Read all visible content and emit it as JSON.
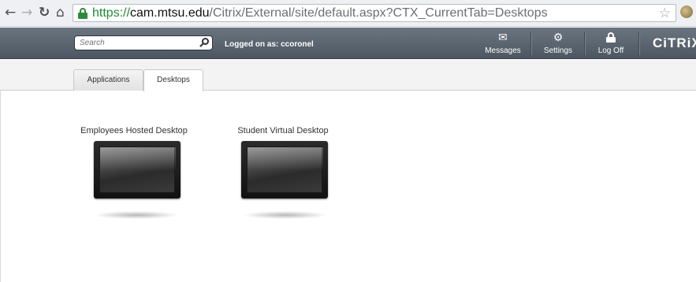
{
  "browser": {
    "url_scheme": "https://",
    "url_host": "cam.mtsu.edu",
    "url_path": "/Citrix/External/site/default.aspx?CTX_CurrentTab=Desktops",
    "icons": [
      "back-arrow-icon",
      "forward-arrow-icon",
      "reload-icon",
      "home-icon",
      "lock-icon",
      "star-icon",
      "extension-icon"
    ]
  },
  "header": {
    "search_placeholder": "Search",
    "logged_on": "Logged on as: ccoronel",
    "messages_label": "Messages",
    "settings_label": "Settings",
    "logoff_label": "Log Off",
    "logo": "CiTRiX",
    "bar_color": "#5b6570"
  },
  "tabs": [
    {
      "label": "Applications",
      "selected": false
    },
    {
      "label": "Desktops",
      "selected": true
    }
  ],
  "desktops": [
    {
      "name": "Employees Hosted Desktop"
    },
    {
      "name": "Student Virtual Desktop"
    }
  ]
}
